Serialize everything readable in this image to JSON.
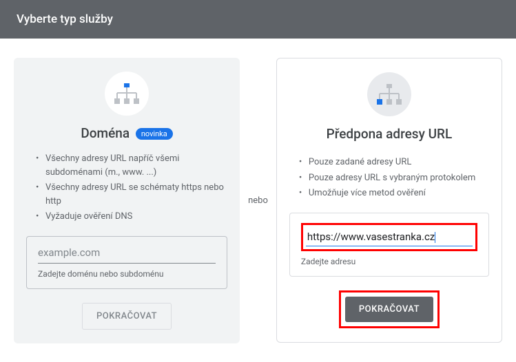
{
  "header": {
    "title": "Vyberte typ služby"
  },
  "separator": "nebo",
  "domain_card": {
    "title": "Doména",
    "badge": "novinka",
    "bullets": [
      "Všechny adresy URL napříč všemi subdoménami (m., www. ...)",
      "Všechny adresy URL se schématy https nebo http",
      "Vyžaduje ověření DNS"
    ],
    "placeholder": "example.com",
    "hint": "Zadejte doménu nebo subdoménu",
    "button": "POKRAČOVAT"
  },
  "url_card": {
    "title": "Předpona adresy URL",
    "bullets": [
      "Pouze zadané adresy URL",
      "Pouze adresy URL s vybraným protokolem",
      "Umožňuje více metod ověření"
    ],
    "value": "https://www.vasestranka.cz",
    "hint": "Zadejte adresu",
    "button": "POKRAČOVAT"
  }
}
